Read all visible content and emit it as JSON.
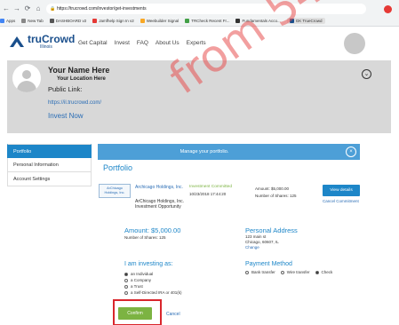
{
  "browser": {
    "url": "https://trucrowd.com/investor/get-investments",
    "bookmarks": [
      "Apps",
      "New Tab",
      "DASHBOARD v2",
      "Jamfhelp Sign In v2",
      "Weebuilder Signal",
      "TRCheck Recent Fr...",
      "Fundamentals Acco...",
      "GK TrueCrowd"
    ]
  },
  "header": {
    "logo_main": "truCrowd",
    "logo_sub": "Illinois",
    "nav": [
      "Get Capital",
      "Invest",
      "FAQ",
      "About Us",
      "Experts"
    ]
  },
  "profile": {
    "name": "Your Name Here",
    "location": "Your Location Here",
    "public_link_label": "Public Link:",
    "public_link": "https://il.trucrowd.com/",
    "invest_now": "Invest Now",
    "chevron": "⌄"
  },
  "sidebar": {
    "items": [
      "Portfolio",
      "Personal Information",
      "Account Settings"
    ]
  },
  "main": {
    "banner_text": "Manage your portfolio.",
    "close_symbol": "×",
    "title": "Portfolio",
    "investment": {
      "thumb_text": "ArChicago Holdings, Inc.",
      "name": "Archicago Holdings, Inc.",
      "sub": "ArChicago Holdings, Inc. Investment Opportunity",
      "status": "Investment Committed",
      "date": "10/23/2018 17:44:20",
      "amount_line": "Amount: $5,000.00",
      "shares_line": "Number of Shares: 125",
      "view_button": "View details",
      "cancel_commitment": "Cancel Commitment"
    },
    "amount": "Amount: $5,000.00",
    "num_shares": "Number of Shares: 125",
    "personal_address": {
      "title": "Personal Address",
      "line1": "123 main st",
      "line2": "Chicago, 60607, IL",
      "change": "Change"
    },
    "investing_as": {
      "title": "I am investing as:",
      "options": [
        "an Individual",
        "a Company",
        "a Trust",
        "a Self-Directed IRA or 401(k)"
      ],
      "selected": 0
    },
    "payment": {
      "title": "Payment Method",
      "options": [
        "Bank transfer",
        "Wire transfer",
        "Check"
      ],
      "selected": 2
    },
    "confirm_button": "Confirm",
    "cancel_link": "Cancel"
  },
  "watermark": "from 54.82.3",
  "colors": {
    "accent": "#1d86c8",
    "confirm": "#7cb342",
    "highlight": "#d9262c"
  }
}
